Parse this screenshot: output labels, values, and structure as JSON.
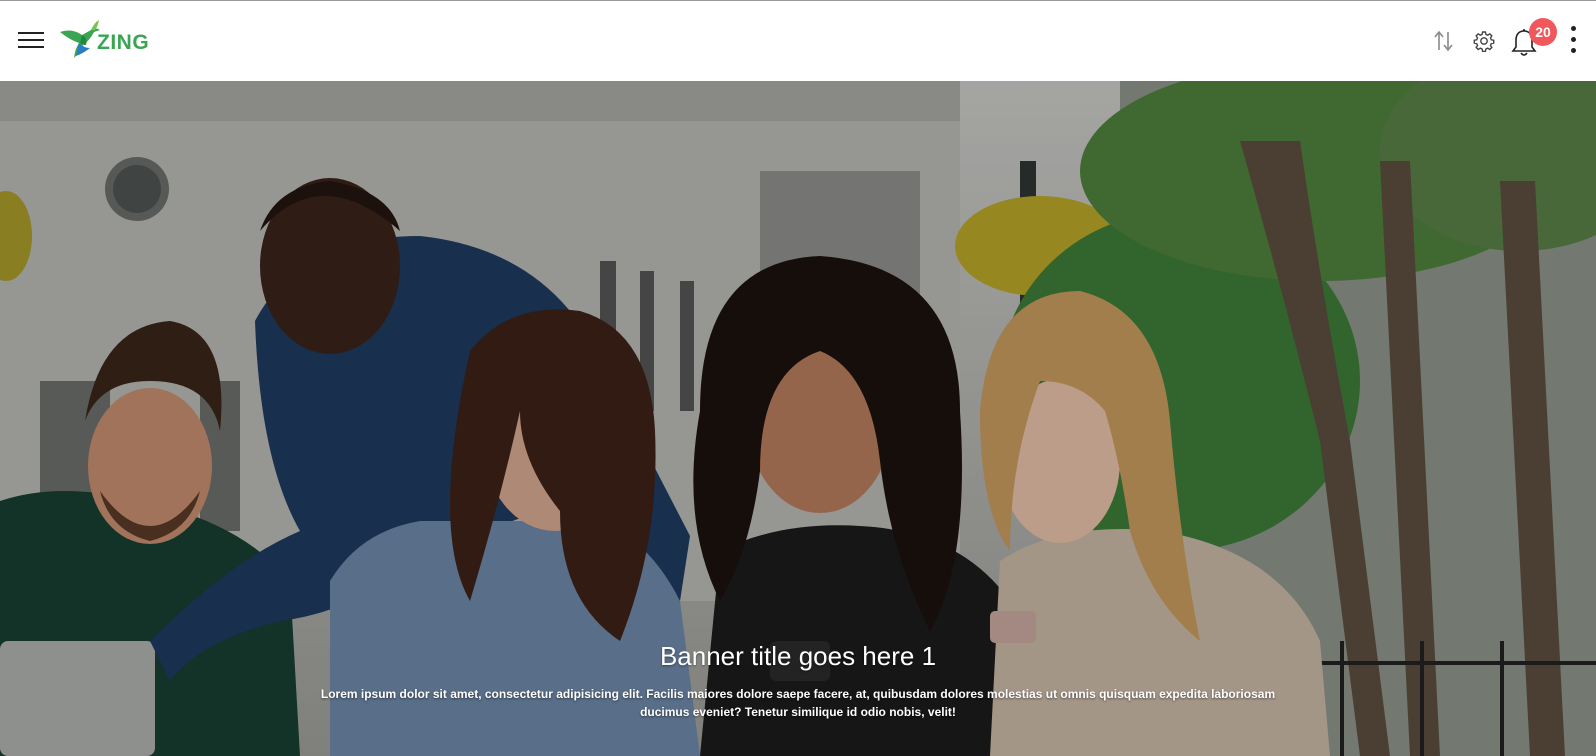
{
  "header": {
    "logo_text": "ZING",
    "brand_color": "#3aa552",
    "notifications_count": "20",
    "badge_color": "#f1585b",
    "icons": [
      "menu-icon",
      "sort-icon",
      "gear-icon",
      "bell-icon",
      "more-vertical-icon"
    ]
  },
  "banner": {
    "title": "Banner title goes here 1",
    "description": "Lorem ipsum dolor sit amet, consectetur adipisicing elit. Facilis maiores dolore saepe facere, at, quibusdam dolores molestias ut omnis quisquam expedita laboriosam ducimus eveniet? Tenetur similique id odio nobis, velit!"
  }
}
